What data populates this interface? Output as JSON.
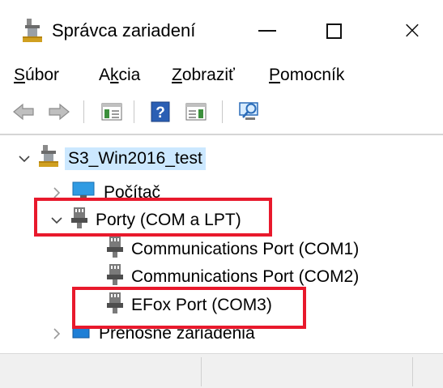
{
  "window": {
    "title": "Správca zariadení",
    "buttons": {
      "minimize": "minimize",
      "maximize": "maximize",
      "close": "×"
    }
  },
  "menu": [
    {
      "label": "Súbor",
      "accel": "S",
      "rest": "úbor"
    },
    {
      "label": "Akcia",
      "pre": "A",
      "accel": "k",
      "rest": "cia"
    },
    {
      "label": "Zobraziť",
      "accel": "Z",
      "rest": "obraziť"
    },
    {
      "label": "Pomocník",
      "accel": "P",
      "rest": "omocník"
    }
  ],
  "toolbar": {
    "icons": [
      "back-arrow-icon",
      "forward-arrow-icon",
      "show-hide-console-tree-icon",
      "help-icon",
      "show-hide-action-pane-icon",
      "monitor-icon"
    ]
  },
  "tree": {
    "root": "S3_Win2016_test",
    "items": [
      {
        "label": "Počítač",
        "expanded": false
      },
      {
        "label": "Porty (COM a LPT)",
        "expanded": true,
        "children": [
          "Communications Port (COM1)",
          "Communications Port (COM2)",
          "EFox Port (COM3)"
        ]
      },
      {
        "label": "Prenosné zariadenia",
        "expanded": false
      }
    ]
  },
  "colors": {
    "highlight_border": "#e8192c",
    "selection": "#cce8ff",
    "accent_blue": "#0078d7"
  }
}
